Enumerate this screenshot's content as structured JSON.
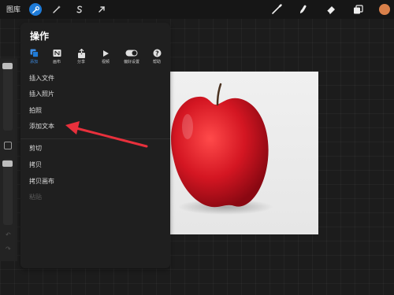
{
  "toolbar": {
    "gallery_label": "图库",
    "left_tools": [
      {
        "icon": "wrench-icon",
        "active": true
      },
      {
        "icon": "magic-wand-icon",
        "active": false
      },
      {
        "icon": "selection-s-icon",
        "active": false
      },
      {
        "icon": "transform-arrow-icon",
        "active": false
      }
    ],
    "right_tools": [
      "brush-icon",
      "smudge-icon",
      "eraser-icon",
      "layers-icon"
    ],
    "current_color": "#d9804a"
  },
  "panel": {
    "title": "操作",
    "tabs": [
      {
        "label": "添加",
        "icon": "add-icon",
        "active": true
      },
      {
        "label": "画布",
        "icon": "canvas-icon",
        "active": false
      },
      {
        "label": "分享",
        "icon": "share-icon",
        "active": false
      },
      {
        "label": "视频",
        "icon": "play-icon",
        "active": false
      },
      {
        "label": "偏好设置",
        "icon": "toggle-icon",
        "active": false
      },
      {
        "label": "帮助",
        "icon": "help-icon",
        "active": false
      }
    ],
    "menu_items": [
      {
        "label": "插入文件",
        "enabled": true
      },
      {
        "label": "插入照片",
        "enabled": true
      },
      {
        "label": "拍照",
        "enabled": true
      },
      {
        "label": "添加文本",
        "enabled": true
      },
      {
        "label": "剪切",
        "enabled": true
      },
      {
        "label": "拷贝",
        "enabled": true
      },
      {
        "label": "拷贝画布",
        "enabled": true
      },
      {
        "label": "粘贴",
        "enabled": false
      }
    ]
  },
  "accent_color": "#1e7bd8",
  "annotation_arrow_color": "#e8303c"
}
